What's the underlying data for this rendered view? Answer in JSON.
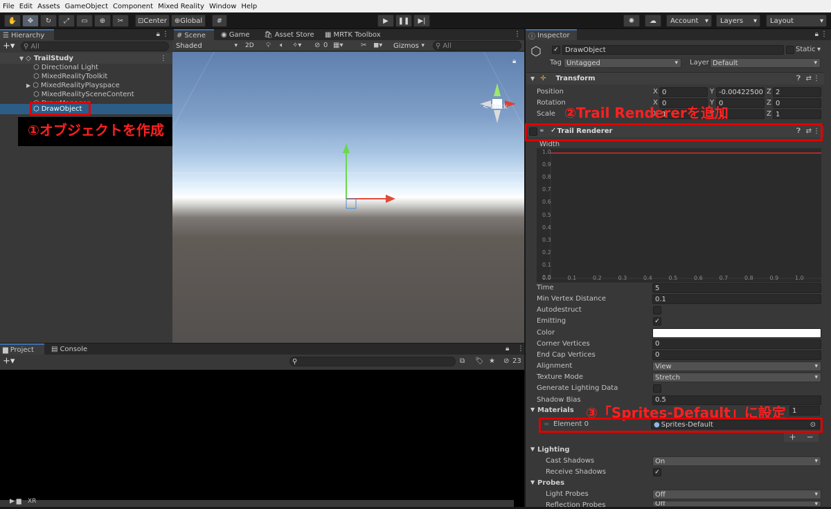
{
  "menu": [
    "File",
    "Edit",
    "Assets",
    "GameObject",
    "Component",
    "Mixed Reality",
    "Window",
    "Help"
  ],
  "toolbar": {
    "pivot": "Center",
    "space": "Global",
    "account": "Account",
    "layers": "Layers",
    "layout": "Layout"
  },
  "hierarchy": {
    "tab": "Hierarchy",
    "search_placeholder": "All",
    "scene": "TrailStudy",
    "items": [
      "Directional Light",
      "MixedRealityToolkit",
      "MixedRealityPlayspace",
      "MixedRealitySceneContent",
      "DrawManager",
      "DrawObject"
    ]
  },
  "scene_view": {
    "tabs": [
      "Scene",
      "Game",
      "Asset Store",
      "MRTK Toolbox"
    ],
    "shading": "Shaded",
    "mode2d": "2D",
    "hidden_count": "0",
    "gizmos": "Gizmos",
    "search_placeholder": "All",
    "back": "< Back"
  },
  "project": {
    "tabs": [
      "Project",
      "Console"
    ],
    "hidden_count": "23",
    "folder": "XR"
  },
  "inspector": {
    "tab": "Inspector",
    "object_name": "DrawObject",
    "static_label": "Static",
    "tag_label": "Tag",
    "tag": "Untagged",
    "layer_label": "Layer",
    "layer": "Default",
    "transform": {
      "title": "Transform",
      "rows": [
        {
          "label": "Position",
          "x": "0",
          "y": "-0.00422500",
          "z": "2"
        },
        {
          "label": "Rotation",
          "x": "0",
          "y": "0",
          "z": "0"
        },
        {
          "label": "Scale",
          "x": "1",
          "y": "1",
          "z": "1"
        }
      ]
    },
    "trail": {
      "title": "Trail Renderer",
      "width_label": "Width",
      "y_ticks": [
        "1.0",
        "0.9",
        "0.8",
        "0.7",
        "0.6",
        "0.5",
        "0.4",
        "0.3",
        "0.2",
        "0.1",
        "0.0"
      ],
      "x_ticks": [
        "0.0",
        "0.1",
        "0.2",
        "0.3",
        "0.4",
        "0.5",
        "0.6",
        "0.7",
        "0.8",
        "0.9",
        "1.0"
      ],
      "props": [
        {
          "label": "Time",
          "value": "5"
        },
        {
          "label": "Min Vertex Distance",
          "value": "0.1"
        },
        {
          "label": "Autodestruct",
          "checkbox": false
        },
        {
          "label": "Emitting",
          "checkbox": true
        },
        {
          "label": "Color",
          "color": "#ffffff"
        },
        {
          "label": "Corner Vertices",
          "value": "0"
        },
        {
          "label": "End Cap Vertices",
          "value": "0"
        },
        {
          "label": "Alignment",
          "dropdown": "View"
        },
        {
          "label": "Texture Mode",
          "dropdown": "Stretch"
        },
        {
          "label": "Generate Lighting Data",
          "checkbox": false
        },
        {
          "label": "Shadow Bias",
          "value": "0.5"
        }
      ],
      "materials_label": "Materials",
      "materials_count": "1",
      "element_label": "Element 0",
      "element_value": "Sprites-Default",
      "lighting_label": "Lighting",
      "cast_shadows_label": "Cast Shadows",
      "cast_shadows": "On",
      "receive_shadows_label": "Receive Shadows",
      "probes_label": "Probes",
      "light_probes_label": "Light Probes",
      "light_probes": "Off",
      "reflection_probes_label": "Reflection Probes",
      "reflection_probes": "Off"
    }
  },
  "annotations": [
    "①オブジェクトを作成",
    "②Trail Rendererを追加",
    "③「Sprites-Default」に設定"
  ]
}
